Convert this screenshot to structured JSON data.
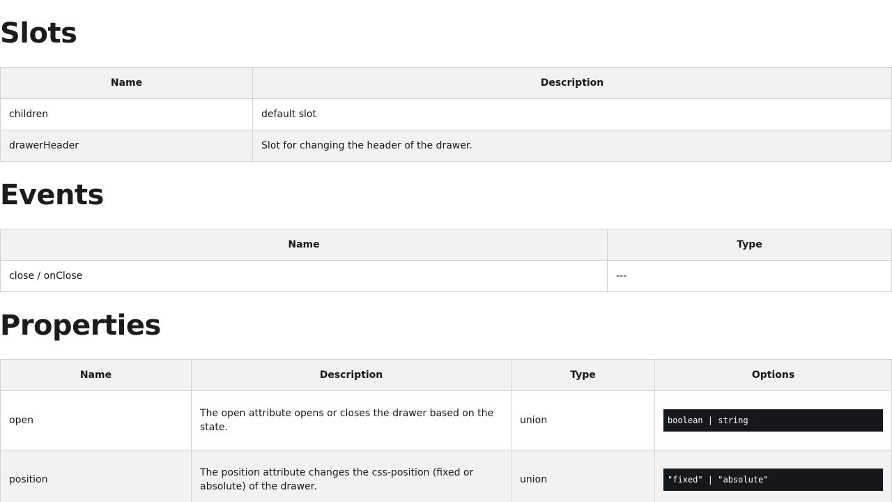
{
  "slots": {
    "heading": "Slots",
    "columns": [
      "Name",
      "Description"
    ],
    "rows": [
      {
        "name": "children",
        "description": "default slot"
      },
      {
        "name": "drawerHeader",
        "description": "Slot for changing the header of the drawer."
      }
    ]
  },
  "events": {
    "heading": "Events",
    "columns": [
      "Name",
      "Type"
    ],
    "rows": [
      {
        "name": "close / onClose",
        "type": "---"
      }
    ]
  },
  "properties": {
    "heading": "Properties",
    "columns": [
      "Name",
      "Description",
      "Type",
      "Options"
    ],
    "rows": [
      {
        "name": "open",
        "description": "The open attribute opens or closes the drawer based on the state.",
        "type": "union",
        "options": "boolean | string"
      },
      {
        "name": "position",
        "description": "The position attribute changes the css-position (fixed or absolute) of the drawer.",
        "type": "union",
        "options": "\"fixed\" | \"absolute\""
      }
    ]
  },
  "colors": {
    "header_bg": "#f2f2f2",
    "border": "#d2d2d2",
    "code_bg": "#16171a",
    "text": "#16171a"
  }
}
